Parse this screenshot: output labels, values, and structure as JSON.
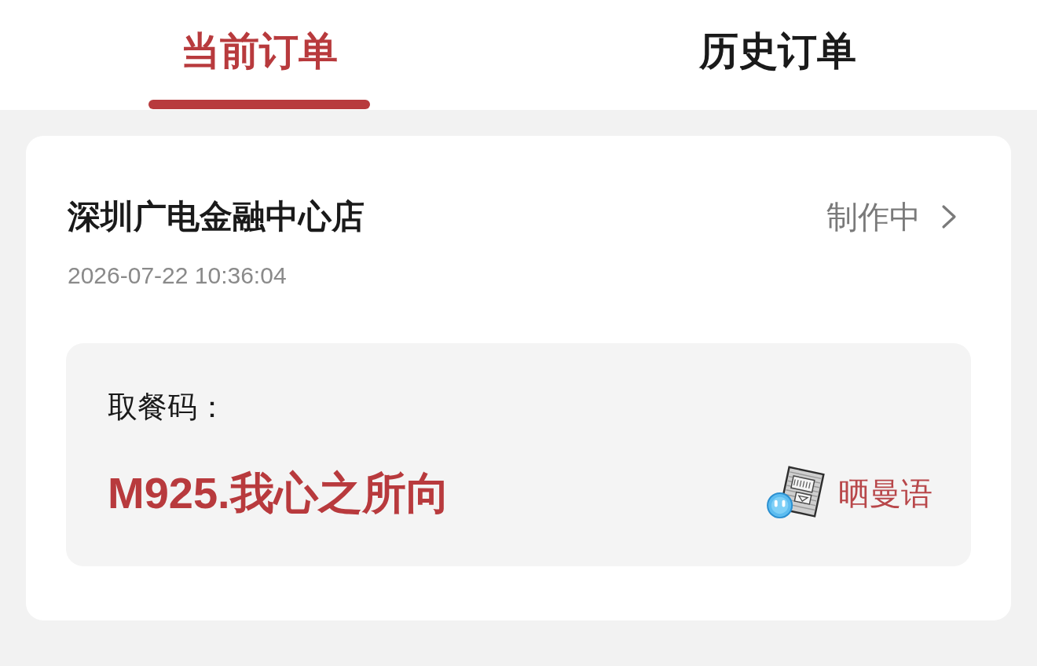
{
  "tabs": [
    {
      "label": "当前订单",
      "selected": true
    },
    {
      "label": "历史订单",
      "selected": false
    }
  ],
  "order": {
    "store": "深圳广电金融中心店",
    "status": "制作中",
    "time": "2026-07-22 10:36:04",
    "pickup": {
      "label": "取餐码：",
      "code": "M925.我心之所向",
      "share_label": "晒曼语"
    }
  }
}
